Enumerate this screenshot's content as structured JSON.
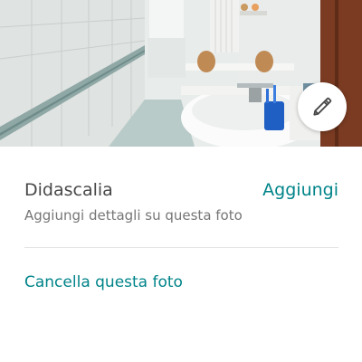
{
  "photo": {
    "alt": "bathroom-photo",
    "edit_icon": "pencil-icon"
  },
  "caption": {
    "title": "Didascalia",
    "add_label": "Aggiungi",
    "hint": "Aggiungi dettagli su questa foto"
  },
  "actions": {
    "delete_label": "Cancella questa foto"
  },
  "colors": {
    "accent": "#008489",
    "text_primary": "#484848",
    "text_secondary": "#767676",
    "divider": "#e4e4e4"
  }
}
